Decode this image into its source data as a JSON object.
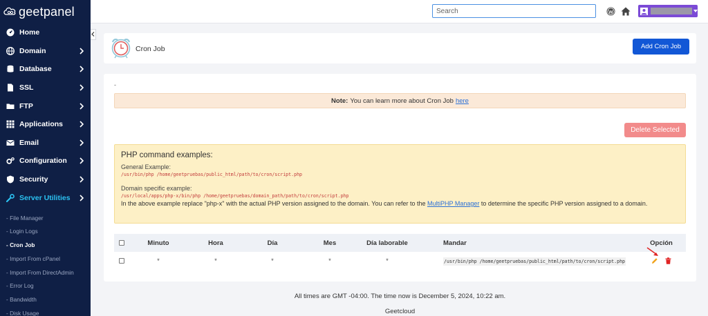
{
  "brand": {
    "name": "geetpanel"
  },
  "search": {
    "placeholder": "Search"
  },
  "sidebar": {
    "items": [
      {
        "label": "Home",
        "icon": "gauge-icon",
        "chevron": false
      },
      {
        "label": "Domain",
        "icon": "globe-icon",
        "chevron": true
      },
      {
        "label": "Database",
        "icon": "database-icon",
        "chevron": true
      },
      {
        "label": "SSL",
        "icon": "file-icon",
        "chevron": true
      },
      {
        "label": "FTP",
        "icon": "folder-icon",
        "chevron": true
      },
      {
        "label": "Applications",
        "icon": "grid-icon",
        "chevron": true
      },
      {
        "label": "Email",
        "icon": "envelope-icon",
        "chevron": true
      },
      {
        "label": "Configuration",
        "icon": "cogs-icon",
        "chevron": true
      },
      {
        "label": "Security",
        "icon": "shield-icon",
        "chevron": true
      },
      {
        "label": "Server Utilities",
        "icon": "wrench-icon",
        "chevron": true,
        "active": true
      }
    ],
    "subitems": [
      {
        "label": "- File Manager"
      },
      {
        "label": "- Login Logs"
      },
      {
        "label": "- Cron Job",
        "active": true
      },
      {
        "label": "- Import From cPanel"
      },
      {
        "label": "- Import From DirectAdmin"
      },
      {
        "label": "- Error Log"
      },
      {
        "label": "- Bandwidth"
      },
      {
        "label": "- Disk Usage"
      }
    ]
  },
  "header": {
    "title": "Cron Job",
    "add_button": "Add Cron Job"
  },
  "main": {
    "dash": "-",
    "note": {
      "prefix": "Note:",
      "text": "You can learn more about Cron Job",
      "link": "here"
    },
    "delete_button": "Delete Selected",
    "examples": {
      "title": "PHP command examples:",
      "general_label": "General Example:",
      "general_code": "/usr/bin/php /home/geetpruebas/public_html/path/to/cron/script.php",
      "domain_label": "Domain specific example:",
      "domain_code": "/usr/local/apps/php-x/bin/php /home/geetpruebas/domain_path/path/to/cron/script.php",
      "desc_before": "In the above example replace \"php-x\" with the actual PHP version assigned to the domain. You can refer to the",
      "desc_link": "MultiPHP Manager",
      "desc_after": "to determine the specific PHP version assigned to a domain."
    },
    "table": {
      "headers": [
        "Minuto",
        "Hora",
        "Día",
        "Mes",
        "Día laborable",
        "Mandar",
        "Opción"
      ],
      "rows": [
        {
          "minuto": "*",
          "hora": "*",
          "dia": "*",
          "mes": "*",
          "dia_laborable": "*",
          "mandar": "/usr/bin/php /home/geetpruebas/public_html/path/to/cron/script.php"
        }
      ]
    }
  },
  "footer": {
    "time": "All times are GMT -04:00. The time now is December 5, 2024, 10:22 am.",
    "brand": "Geetcloud"
  },
  "colors": {
    "sidebar": "#0f1f45",
    "accent": "#1257d6",
    "active": "#2bc2f2",
    "delete": "#f28b8b",
    "user": "#7b4ad6"
  }
}
